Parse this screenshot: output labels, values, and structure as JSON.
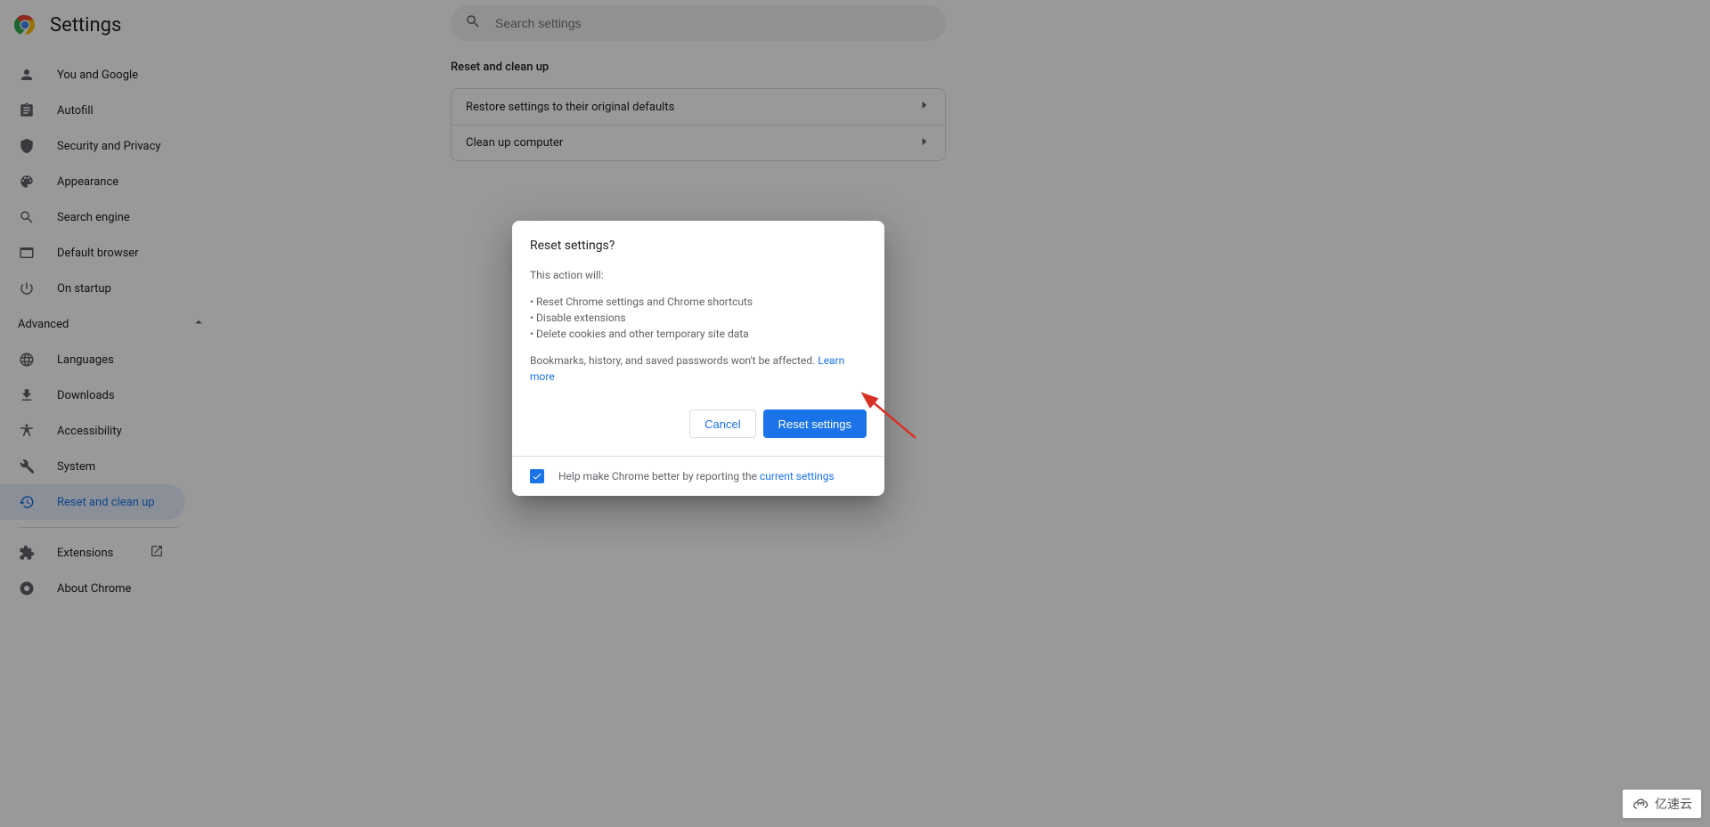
{
  "header": {
    "title": "Settings"
  },
  "search": {
    "placeholder": "Search settings"
  },
  "sidebar": {
    "items": [
      {
        "id": "you-and-google",
        "label": "You and Google",
        "icon": "person-icon"
      },
      {
        "id": "autofill",
        "label": "Autofill",
        "icon": "clipboard-icon"
      },
      {
        "id": "security-privacy",
        "label": "Security and Privacy",
        "icon": "shield-icon"
      },
      {
        "id": "appearance",
        "label": "Appearance",
        "icon": "palette-icon"
      },
      {
        "id": "search-engine",
        "label": "Search engine",
        "icon": "search-icon"
      },
      {
        "id": "default-browser",
        "label": "Default browser",
        "icon": "browser-icon"
      },
      {
        "id": "on-startup",
        "label": "On startup",
        "icon": "power-icon"
      }
    ],
    "advanced_label": "Advanced",
    "advanced_items": [
      {
        "id": "languages",
        "label": "Languages",
        "icon": "globe-icon"
      },
      {
        "id": "downloads",
        "label": "Downloads",
        "icon": "download-icon"
      },
      {
        "id": "accessibility",
        "label": "Accessibility",
        "icon": "accessibility-icon"
      },
      {
        "id": "system",
        "label": "System",
        "icon": "wrench-icon"
      },
      {
        "id": "reset-cleanup",
        "label": "Reset and clean up",
        "icon": "restore-icon",
        "active": true
      }
    ],
    "footer_items": [
      {
        "id": "extensions",
        "label": "Extensions",
        "icon": "extension-icon",
        "external": true
      },
      {
        "id": "about-chrome",
        "label": "About Chrome",
        "icon": "chrome-icon"
      }
    ]
  },
  "main": {
    "section_title": "Reset and clean up",
    "rows": [
      {
        "id": "restore-defaults",
        "label": "Restore settings to their original defaults"
      },
      {
        "id": "clean-up-computer",
        "label": "Clean up computer"
      }
    ]
  },
  "dialog": {
    "title": "Reset settings?",
    "intro": "This action will:",
    "bullets": [
      "Reset Chrome settings and Chrome shortcuts",
      "Disable extensions",
      "Delete cookies and other temporary site data"
    ],
    "note_before_link": "Bookmarks, history, and saved passwords won't be affected. ",
    "learn_more": "Learn more",
    "cancel": "Cancel",
    "confirm": "Reset settings",
    "footer_before_link": "Help make Chrome better by reporting the ",
    "footer_link": "current settings",
    "checkbox_checked": true
  },
  "watermark": {
    "text": "亿速云"
  }
}
